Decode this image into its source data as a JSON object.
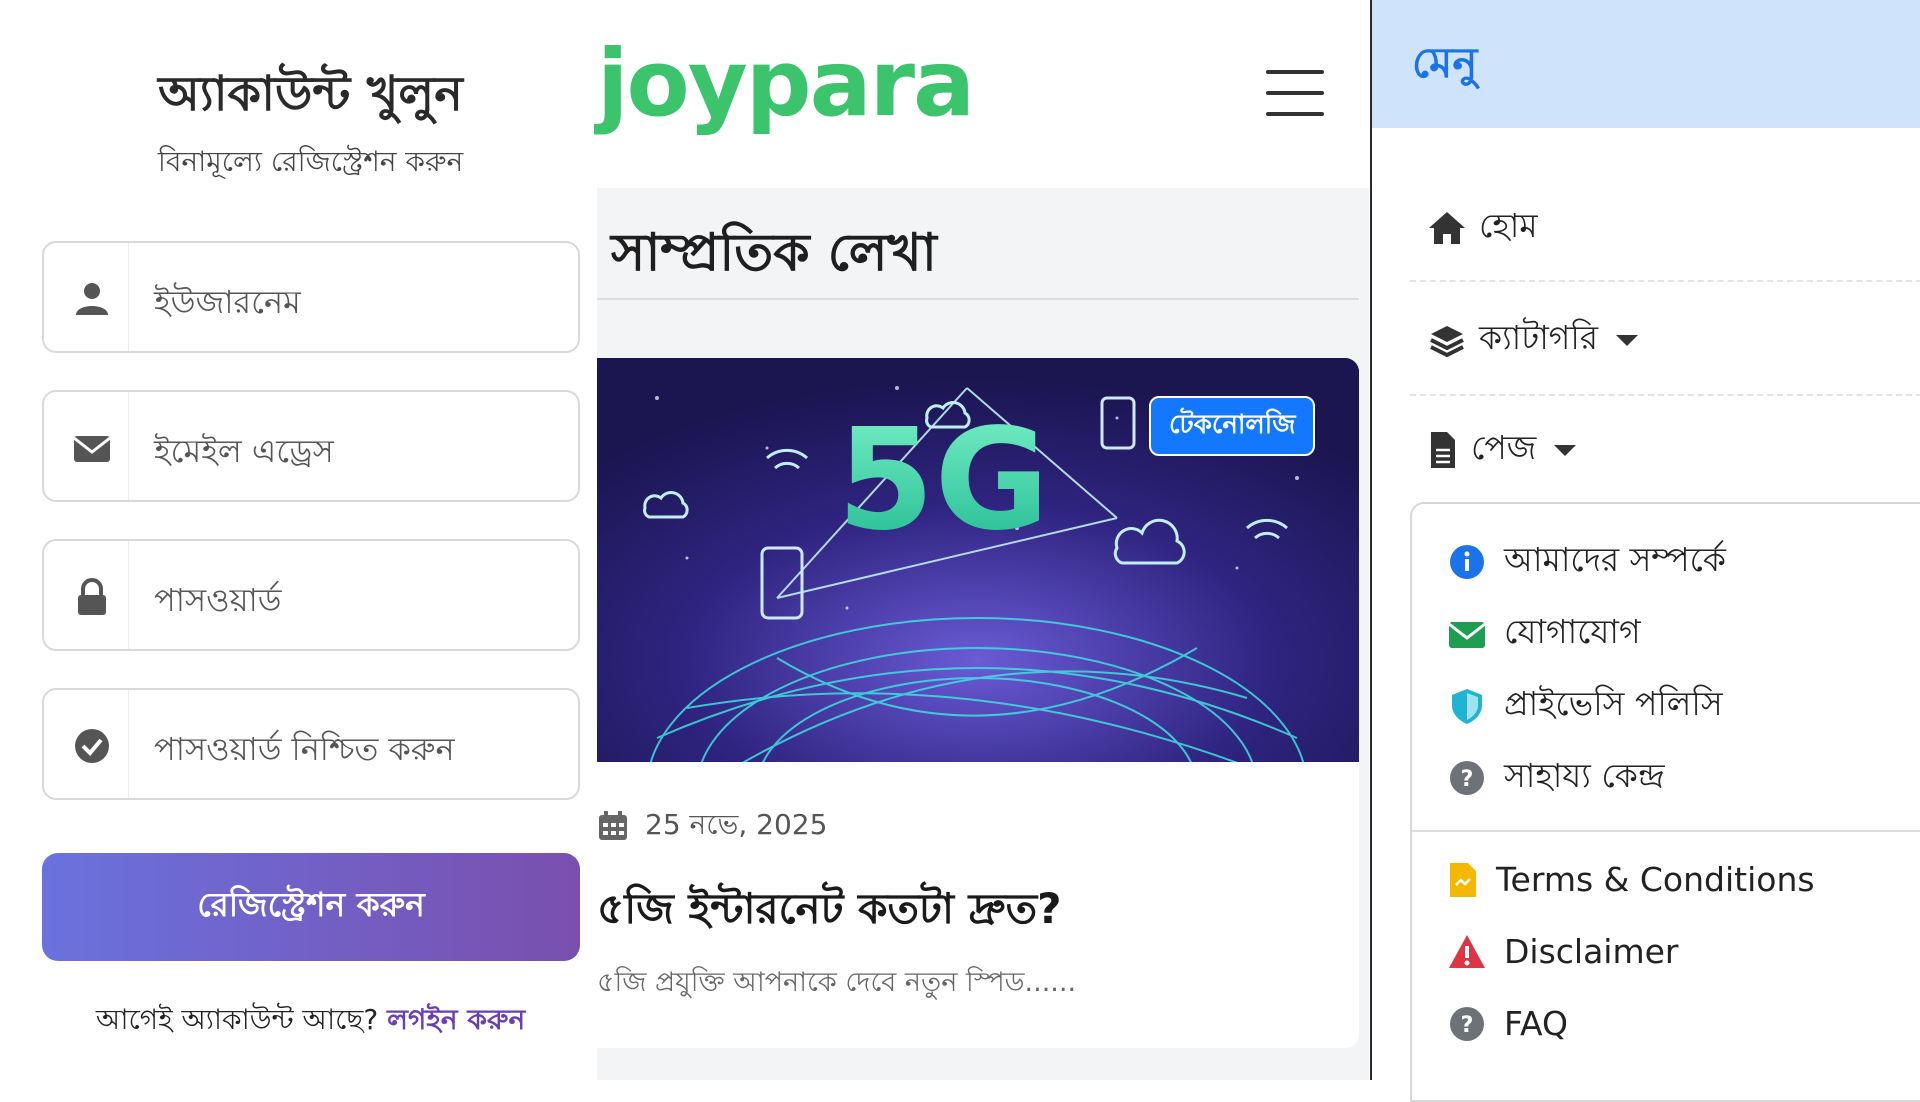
{
  "registration": {
    "title": "অ্যাকাউন্ট খুলুন",
    "subtitle": "বিনামূল্যে রেজিস্ট্রেশন করুন",
    "fields": [
      {
        "placeholder": "ইউজারনেম",
        "icon": "user-icon"
      },
      {
        "placeholder": "ইমেইল এড্রেস",
        "icon": "envelope-icon"
      },
      {
        "placeholder": "পাসওয়ার্ড",
        "icon": "lock-icon"
      },
      {
        "placeholder": "পাসওয়ার্ড নিশ্চিত করুন",
        "icon": "check-circle-icon"
      }
    ],
    "submit_label": "রেজিস্ট্রেশন করুন",
    "footer_text": "আগেই অ্যাকাউন্ট আছে?",
    "login_link": "লগইন করুন",
    "button_gradient": [
      "#6a72de",
      "#7a4fae"
    ]
  },
  "site": {
    "logo": "joypara",
    "logo_color": "#3cc46c"
  },
  "blog": {
    "section_title": "সাম্প্রতিক লেখা",
    "post": {
      "category": "টেকনোলজি",
      "image_text": "5G",
      "date": "25 নভে, 2025",
      "title": "৫জি ইন্টারনেট কতটা দ্রুত?",
      "excerpt": "৫জি প্রযুক্তি আপনাকে দেবে নতুন স্পিড......"
    }
  },
  "menu": {
    "title": "মেনু",
    "header_color": "#cfe3fb",
    "items": [
      {
        "label": "হোম",
        "icon": "home-icon"
      },
      {
        "label": "ক্যাটাগরি",
        "icon": "layers-icon",
        "has_dropdown": true
      },
      {
        "label": "পেজ",
        "icon": "file-icon",
        "has_dropdown": true
      }
    ],
    "page_submenu": [
      {
        "label": "আমাদের সম্পর্কে",
        "icon": "info-icon",
        "color": "#1a73e8"
      },
      {
        "label": "যোগাযোগ",
        "icon": "envelope-icon",
        "color": "#1e9e50"
      },
      {
        "label": "প্রাইভেসি পলিসি",
        "icon": "shield-icon",
        "color": "#1fb3d6"
      },
      {
        "label": "সাহায্য কেন্দ্র",
        "icon": "question-icon",
        "color": "#6c7278"
      }
    ],
    "page_submenu_extra": [
      {
        "label": "Terms & Conditions",
        "icon": "document-icon",
        "color": "#f5b800"
      },
      {
        "label": "Disclaimer",
        "icon": "warning-icon",
        "color": "#dc3545"
      },
      {
        "label": "FAQ",
        "icon": "question-icon",
        "color": "#6c7278"
      }
    ]
  }
}
